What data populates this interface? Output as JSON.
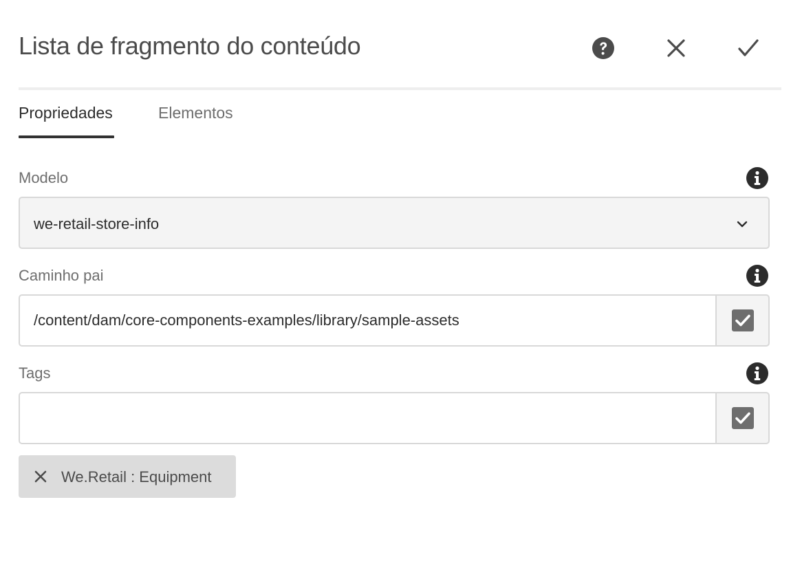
{
  "dialog": {
    "title": "Lista de fragmento do conteúdo",
    "actions": {
      "help": "help-icon",
      "close": "close-icon",
      "done": "checkmark-icon"
    }
  },
  "tabs": [
    {
      "label": "Propriedades",
      "active": true
    },
    {
      "label": "Elementos",
      "active": false
    }
  ],
  "fields": {
    "model": {
      "label": "Modelo",
      "value": "we-retail-store-info"
    },
    "parent_path": {
      "label": "Caminho pai",
      "value": "/content/dam/core-components-examples/library/sample-assets"
    },
    "tags": {
      "label": "Tags",
      "value": "",
      "chips": [
        {
          "label": "We.Retail : Equipment"
        }
      ]
    }
  },
  "colors": {
    "text": "#2c2c2c",
    "label": "#6e6e6e",
    "border": "#d8d8d8",
    "field_bg": "#f4f4f4",
    "chip_bg": "#dcdcdc"
  }
}
